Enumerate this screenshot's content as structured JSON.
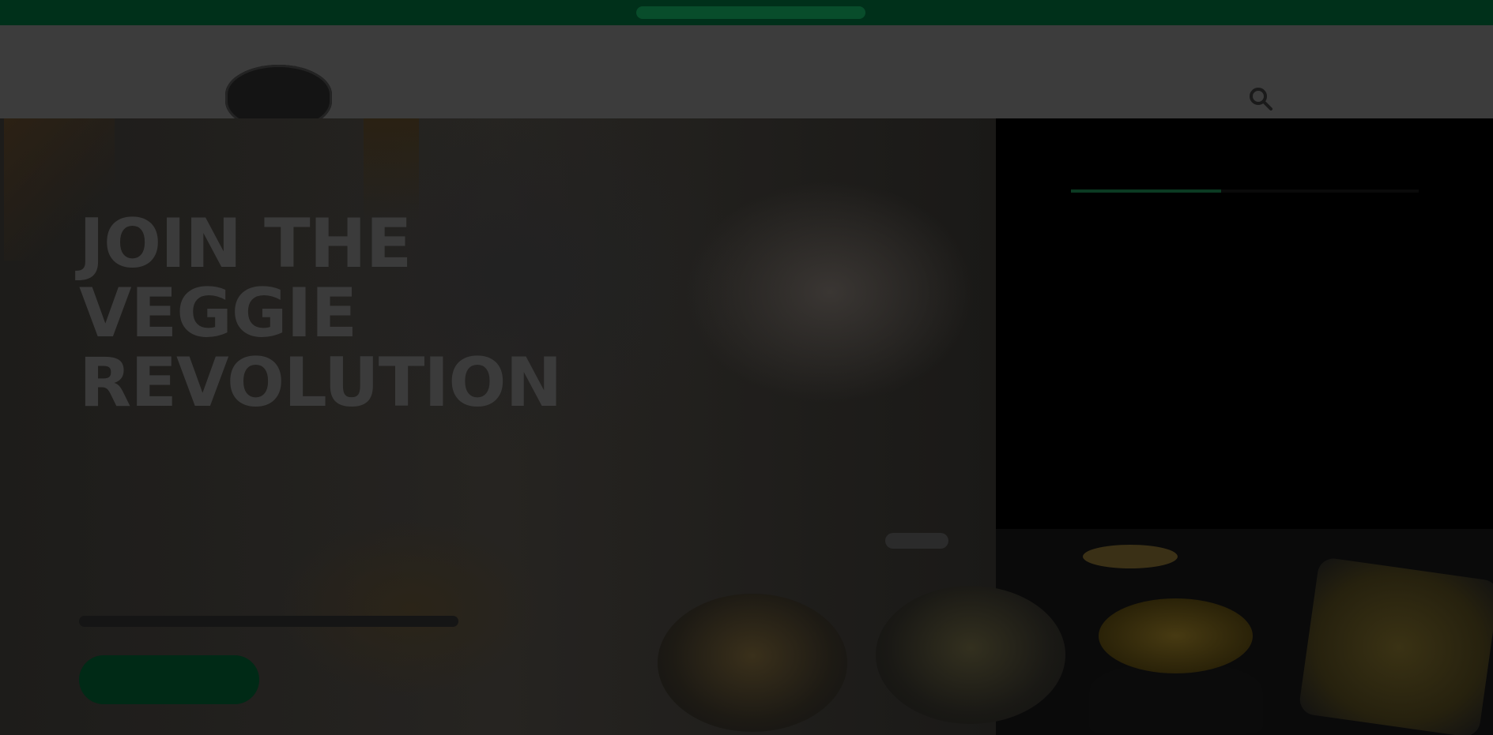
{
  "top_banner": {
    "text": ""
  },
  "header": {
    "logo_text": "",
    "nav": [
      "",
      "",
      ""
    ],
    "search_icon": "search-icon"
  },
  "hero": {
    "title": "JOIN THE VEGGIE REVOLUTION",
    "subtitle": "",
    "cta": ""
  },
  "dropdown": {
    "items": [
      "",
      "",
      "",
      ""
    ]
  },
  "colors": {
    "top_banner": "#00301a",
    "header": "#3c3c3c",
    "cta": "#002a16",
    "dropdown_bg": "#000000",
    "overlay": "rgba(0,0,0,0.75)"
  }
}
